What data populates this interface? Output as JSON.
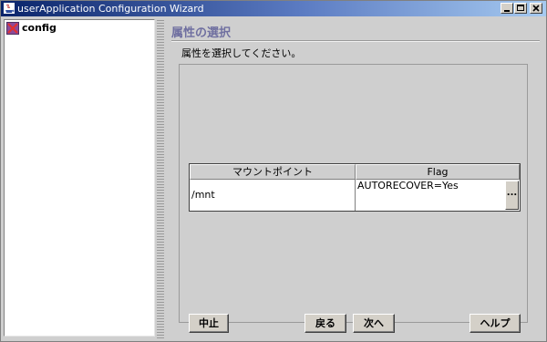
{
  "window": {
    "title": "userApplication Configuration Wizard"
  },
  "sidebar": {
    "tree_root_label": "config"
  },
  "main": {
    "page_title": "属性の選択",
    "instruction": "属性を選択してください。",
    "table": {
      "columns": [
        "マウントポイント",
        "Flag"
      ],
      "rows": [
        {
          "mount_point": "/mnt",
          "flag": "AUTORECOVER=Yes"
        }
      ],
      "ellipsis_label": "..."
    }
  },
  "footer": {
    "cancel_label": "中止",
    "back_label": "戻る",
    "next_label": "次へ",
    "help_label": "ヘルプ"
  }
}
